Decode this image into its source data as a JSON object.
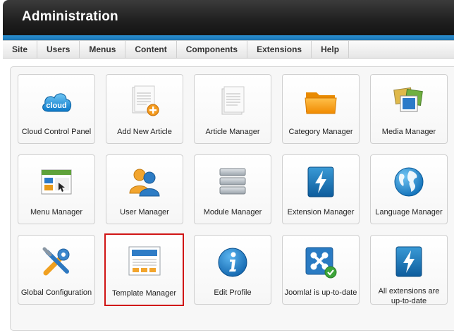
{
  "header": {
    "title": "Administration"
  },
  "menu": [
    "Site",
    "Users",
    "Menus",
    "Content",
    "Components",
    "Extensions",
    "Help"
  ],
  "tiles": [
    {
      "label": "Cloud Control Panel",
      "icon": "cloud-icon"
    },
    {
      "label": "Add New Article",
      "icon": "add-article-icon"
    },
    {
      "label": "Article Manager",
      "icon": "article-icon"
    },
    {
      "label": "Category Manager",
      "icon": "folder-icon"
    },
    {
      "label": "Media Manager",
      "icon": "media-icon"
    },
    {
      "label": "Menu Manager",
      "icon": "menu-window-icon"
    },
    {
      "label": "User Manager",
      "icon": "users-icon"
    },
    {
      "label": "Module Manager",
      "icon": "module-stack-icon"
    },
    {
      "label": "Extension Manager",
      "icon": "lightning-icon"
    },
    {
      "label": "Language Manager",
      "icon": "globe-icon"
    },
    {
      "label": "Global Configuration",
      "icon": "tools-icon"
    },
    {
      "label": "Template Manager",
      "icon": "template-icon"
    },
    {
      "label": "Edit Profile",
      "icon": "info-icon"
    },
    {
      "label": "Joomla! is up-to-date",
      "icon": "joomla-check-icon"
    },
    {
      "label": "All extensions are up-to-date",
      "icon": "lightning-icon"
    }
  ],
  "colors": {
    "header_stripe": "#1a74b3",
    "selected_border": "#d01515"
  }
}
